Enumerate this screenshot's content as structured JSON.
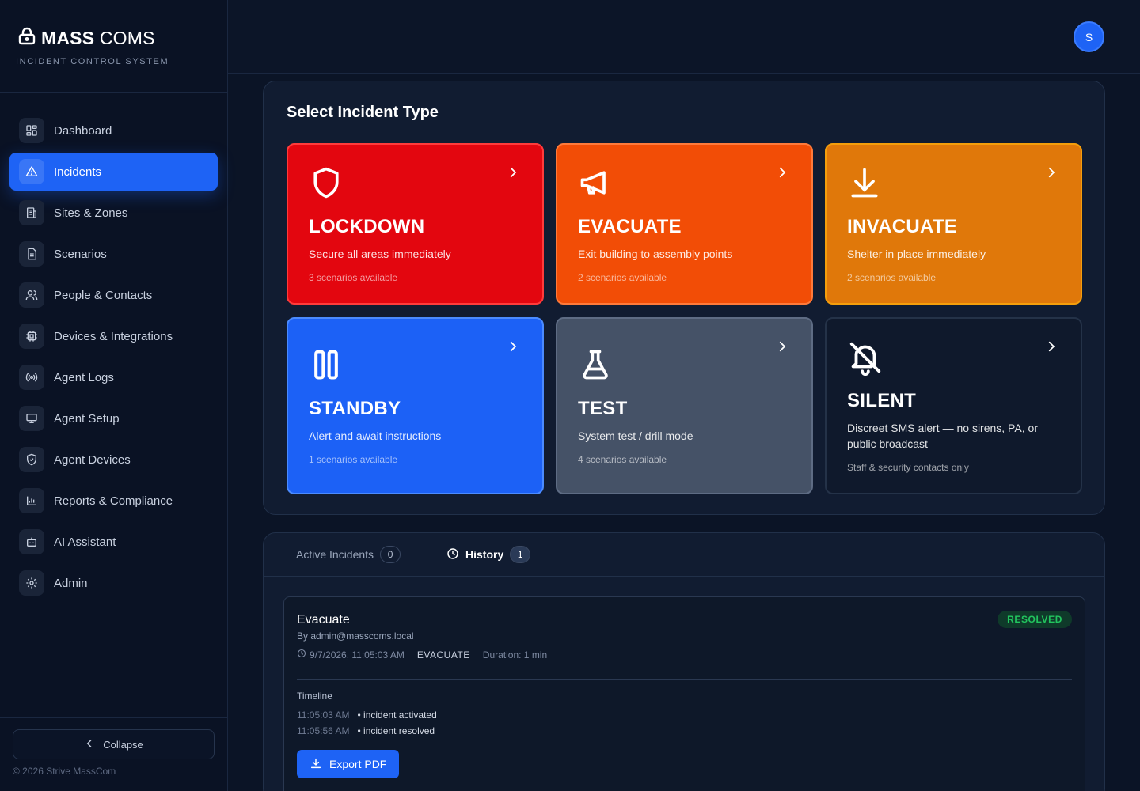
{
  "brand": {
    "name_bold": "MASS",
    "name_light": " COMS",
    "subtitle": "INCIDENT CONTROL SYSTEM"
  },
  "sidebar": {
    "items": [
      {
        "label": "Dashboard",
        "icon": "dashboard-icon"
      },
      {
        "label": "Incidents",
        "icon": "alert-triangle-icon",
        "active": true
      },
      {
        "label": "Sites & Zones",
        "icon": "building-icon"
      },
      {
        "label": "Scenarios",
        "icon": "document-icon"
      },
      {
        "label": "People & Contacts",
        "icon": "users-icon"
      },
      {
        "label": "Devices & Integrations",
        "icon": "chip-icon"
      },
      {
        "label": "Agent Logs",
        "icon": "broadcast-icon"
      },
      {
        "label": "Agent Setup",
        "icon": "monitor-icon"
      },
      {
        "label": "Agent Devices",
        "icon": "shield-check-icon"
      },
      {
        "label": "Reports & Compliance",
        "icon": "bar-chart-icon"
      },
      {
        "label": "AI Assistant",
        "icon": "bot-icon"
      },
      {
        "label": "Admin",
        "icon": "gear-icon"
      }
    ],
    "collapse_label": "Collapse",
    "copyright": "© 2026 Strive MassCom"
  },
  "user": {
    "initial": "S"
  },
  "incident_types": {
    "title": "Select Incident Type",
    "cards": [
      {
        "title": "LOCKDOWN",
        "desc": "Secure all areas immediately",
        "meta": "3 scenarios available",
        "color": "#e3060f"
      },
      {
        "title": "EVACUATE",
        "desc": "Exit building to assembly points",
        "meta": "2 scenarios available",
        "color": "#f24d06"
      },
      {
        "title": "INVACUATE",
        "desc": "Shelter in place immediately",
        "meta": "2 scenarios available",
        "color": "#e0780a"
      },
      {
        "title": "STANDBY",
        "desc": "Alert and await instructions",
        "meta": "1 scenarios available",
        "color": "#1c61f6"
      },
      {
        "title": "TEST",
        "desc": "System test / drill mode",
        "meta": "4 scenarios available",
        "color": "#455267"
      },
      {
        "title": "SILENT",
        "desc": "Discreet SMS alert — no sirens, PA, or public broadcast",
        "meta": "Staff & security contacts only",
        "color": "#0f192c"
      }
    ]
  },
  "tabs": {
    "active": {
      "label": "Active Incidents",
      "count": "0"
    },
    "history": {
      "label": "History",
      "count": "1"
    }
  },
  "incident": {
    "title": "Evacuate",
    "by": "By admin@masscoms.local",
    "time": "9/7/2026, 11:05:03 AM",
    "type": "EVACUATE",
    "duration": "Duration: 1 min",
    "status": "RESOLVED",
    "timeline_title": "Timeline",
    "timeline": [
      {
        "time": "11:05:03 AM",
        "event": "• incident activated"
      },
      {
        "time": "11:05:56 AM",
        "event": "• incident resolved"
      }
    ],
    "export_label": "Export PDF"
  }
}
